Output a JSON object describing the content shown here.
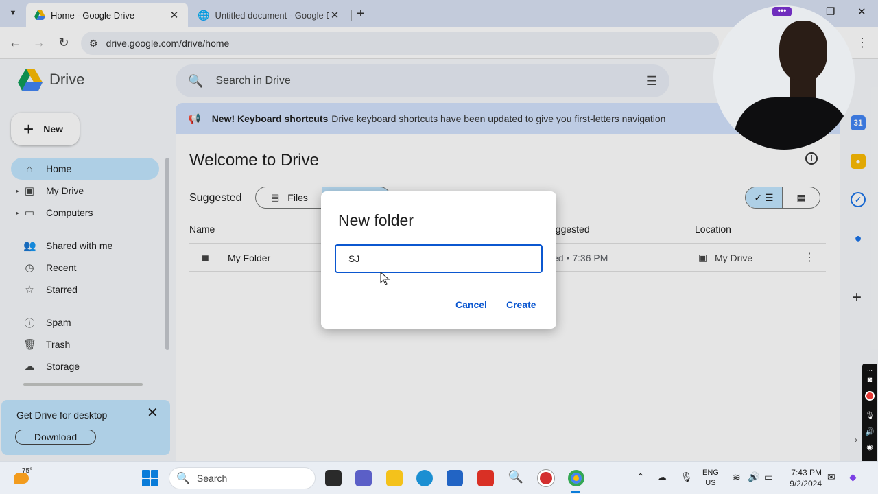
{
  "browser": {
    "tabs": [
      {
        "title": "Home - Google Drive",
        "active": true
      },
      {
        "title": "Untitled document - Google Docs",
        "active": false
      }
    ],
    "url": "drive.google.com/drive/home"
  },
  "app": {
    "name": "Drive",
    "new_button": "New",
    "nav": [
      {
        "label": "Home",
        "icon": "home-icon",
        "active": true
      },
      {
        "label": "My Drive",
        "icon": "my-drive-icon"
      },
      {
        "label": "Computers",
        "icon": "computer-icon"
      },
      {
        "label": "Shared with me",
        "icon": "people-icon"
      },
      {
        "label": "Recent",
        "icon": "clock-icon"
      },
      {
        "label": "Starred",
        "icon": "star-icon"
      },
      {
        "label": "Spam",
        "icon": "spam-icon"
      },
      {
        "label": "Trash",
        "icon": "trash-icon"
      },
      {
        "label": "Storage",
        "icon": "cloud-icon"
      }
    ],
    "promo": {
      "title": "Get Drive for desktop",
      "button": "Download"
    },
    "search_placeholder": "Search in Drive",
    "banner": {
      "bold": "New! Keyboard shortcuts",
      "text": "Drive keyboard shortcuts have been updated to give you first-letters navigation"
    },
    "welcome": "Welcome to Drive",
    "suggested_label": "Suggested",
    "filter_files": "Files",
    "columns": {
      "name": "Name",
      "reason": "uggested",
      "location": "Location"
    },
    "rows": [
      {
        "name": "My Folder",
        "time": "ed • 7:36 PM",
        "location": "My Drive"
      }
    ]
  },
  "dialog": {
    "title": "New folder",
    "input_value": "SJ",
    "cancel": "Cancel",
    "create": "Create"
  },
  "taskbar": {
    "temperature": "75°",
    "search": "Search",
    "lang1": "ENG",
    "lang2": "US",
    "time": "7:43 PM",
    "date": "9/2/2024"
  },
  "colors": {
    "accent": "#0b57d0",
    "selected": "#c2e7ff",
    "banner": "#d3e3fd"
  }
}
